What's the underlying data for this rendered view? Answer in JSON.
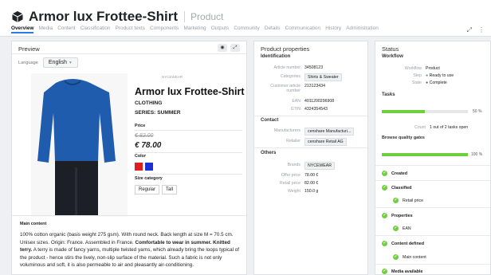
{
  "app": {
    "title": "Armor lux Frottee-Shirt",
    "subtitle": "Product"
  },
  "tabs": [
    "Overview",
    "Media",
    "Content",
    "Classification",
    "Product texts",
    "Components",
    "Marketing",
    "Outputs",
    "Community",
    "Details",
    "Communication",
    "History",
    "Administration"
  ],
  "preview": {
    "title": "Preview",
    "language_label": "Language",
    "language_value": "English",
    "small_brand": "NYCEWEAR",
    "product_name": "Armor lux Frottee-Shirt",
    "category": "CLOTHING",
    "series": "SERIES: SUMMER",
    "price_label": "Price",
    "old_price": "€ 82.00",
    "price": "€ 78.00",
    "color_label": "Color",
    "colors": [
      "#e01e1e",
      "#1f2fd6"
    ],
    "size_label": "Size category",
    "sizes": [
      "Regular",
      "Tall"
    ],
    "main_content_title": "Main content",
    "main_content_pre": "100% cotton organic (basis weight 275 gsm). With round neck. Back length at size M = 70.5 cm. Unisex sizes. Origin: France. Assembled in France.",
    "main_content_bold": "Comfortable to wear in summer. Knitted terry.",
    "main_content_post": "A terry is made of fancy yarns, multiple twisted yarns, which already bring the loops typical of the product - hence stirs the lively, non-slip surface of the material. Such a fabric is not only voluminous and soft, it is also permeable to air and pleasantly air-conditioning."
  },
  "properties": {
    "title": "Product properties",
    "identification": {
      "title": "Identification",
      "rows": [
        {
          "label": "Article number",
          "value": "34508123"
        },
        {
          "label": "Categories",
          "value": "Shirts & Sweater"
        },
        {
          "label": "Customer article number",
          "value": "213123434"
        },
        {
          "label": "EAN",
          "value": "4011200296908"
        },
        {
          "label": "GTIN",
          "value": "4324354543"
        }
      ]
    },
    "contact": {
      "title": "Contact",
      "rows": [
        {
          "label": "Manufacturers",
          "value": "censhare Manufacturi..."
        },
        {
          "label": "Retailer",
          "value": "censhare Retail AG"
        }
      ]
    },
    "others": {
      "title": "Others",
      "rows": [
        {
          "label": "Brands",
          "value": "NYCEWEAR"
        },
        {
          "label": "Offer price",
          "value": "78.00 €"
        },
        {
          "label": "Retail price",
          "value": "82.00 €"
        },
        {
          "label": "Weight",
          "value": "150.0 g"
        }
      ]
    }
  },
  "status": {
    "title": "Status",
    "workflow_title": "Workflow",
    "workflow": [
      {
        "label": "Workflow",
        "value": "Product"
      },
      {
        "label": "Step",
        "value": "Ready to use"
      },
      {
        "label": "State",
        "value": "Complete"
      }
    ],
    "tasks_title": "Tasks",
    "tasks_percent": "50 %",
    "tasks_progress": 0.5,
    "count_label": "Count",
    "count_value": "1 out of 2 tasks open",
    "gates_title": "Browse quality gates",
    "gates_percent": "100 %",
    "gates_progress": 1.0,
    "gates": [
      "Created",
      "Classified",
      "Retail price",
      "Properties",
      "EAN",
      "Content defined",
      "Main content",
      "Media available"
    ],
    "accent": "#6fcf3d"
  }
}
